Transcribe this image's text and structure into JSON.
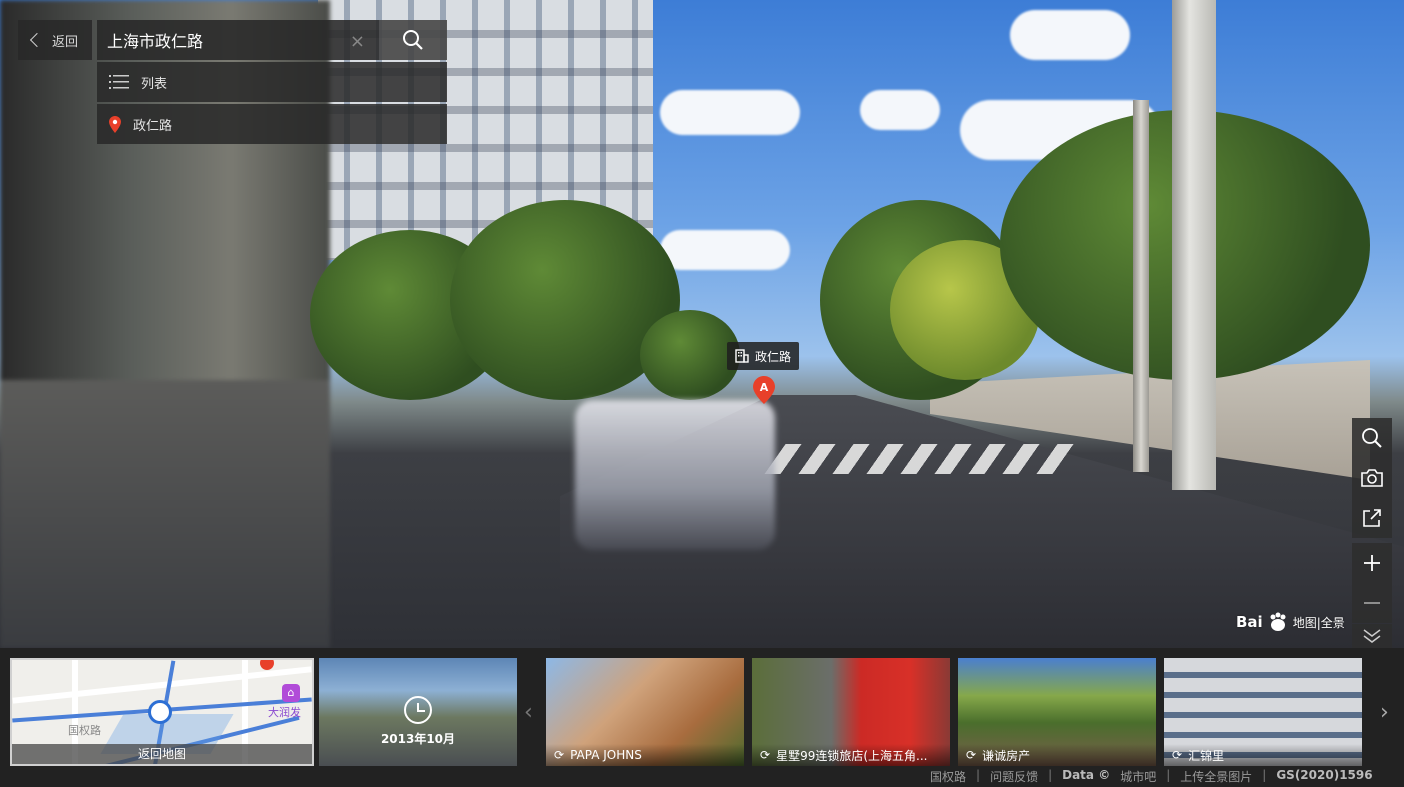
{
  "search": {
    "back_label": "返回",
    "query": "上海市政仁路",
    "clear_symbol": "×"
  },
  "results": {
    "list_label": "列表",
    "place_label": "政仁路"
  },
  "marker": {
    "label": "政仁路",
    "letter": "A"
  },
  "logo": {
    "brand": "Bai",
    "suffix": "地图|全景"
  },
  "thumbnails": {
    "map_label": "返回地图",
    "map_poi": "大润发",
    "map_street": "国权路",
    "history_date": "2013年10月",
    "items": [
      {
        "label": "PAPA JOHNS"
      },
      {
        "label": "星墅99连锁旅店(上海五角..."
      },
      {
        "label": "谦诚房产"
      },
      {
        "label": "汇锦里"
      }
    ]
  },
  "footer": {
    "links": [
      "国权路",
      "问题反馈",
      "Data ©",
      "城市吧",
      "上传全景图片",
      "GS(2020)1596"
    ]
  },
  "colors": {
    "accent": "#4a7fd8",
    "marker_red": "#e8402a",
    "panel_bg": "#282828"
  }
}
